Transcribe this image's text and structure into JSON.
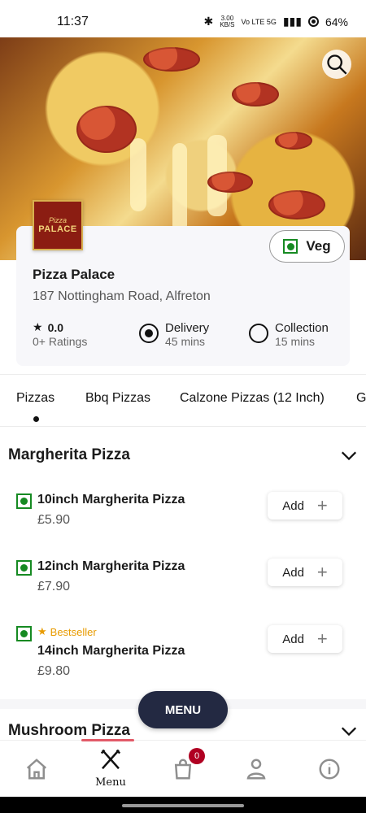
{
  "status": {
    "time": "11:37",
    "speed": "3.00\nKB/S",
    "network": "Vo LTE 5G",
    "battery": "64%"
  },
  "store": {
    "logo_small": "Pizza",
    "logo_large": "PALACE",
    "name": "Pizza Palace",
    "address": "187 Nottingham Road, Alfreton",
    "veg_label": "Veg",
    "rating": "0.0",
    "ratings_count": "0+ Ratings",
    "delivery_label": "Delivery",
    "delivery_time": "45 mins",
    "collection_label": "Collection",
    "collection_time": "15 mins",
    "selected_mode": "Delivery"
  },
  "tabs": [
    "Pizzas",
    "Bbq Pizzas",
    "Calzone Pizzas (12 Inch)",
    "G"
  ],
  "active_tab": "Pizzas",
  "sections": [
    {
      "title": "Margherita Pizza",
      "items": [
        {
          "name": "10inch Margherita Pizza",
          "price": "£5.90",
          "add": "Add"
        },
        {
          "name": "12inch Margherita Pizza",
          "price": "£7.90",
          "add": "Add"
        },
        {
          "name": "14inch Margherita Pizza",
          "price": "£9.80",
          "add": "Add",
          "badge": "Bestseller"
        }
      ]
    },
    {
      "title": "Mushroom Pizza"
    }
  ],
  "menu_button": "MENU",
  "bottom_nav": {
    "home_icon": "home-icon",
    "menu_label": "Menu",
    "cart_count": "0",
    "profile_icon": "profile-icon",
    "info_icon": "info-icon"
  },
  "colors": {
    "veg_green": "#168a22",
    "fab": "#232942",
    "bestseller": "#e89b00",
    "badge": "#b00022"
  }
}
